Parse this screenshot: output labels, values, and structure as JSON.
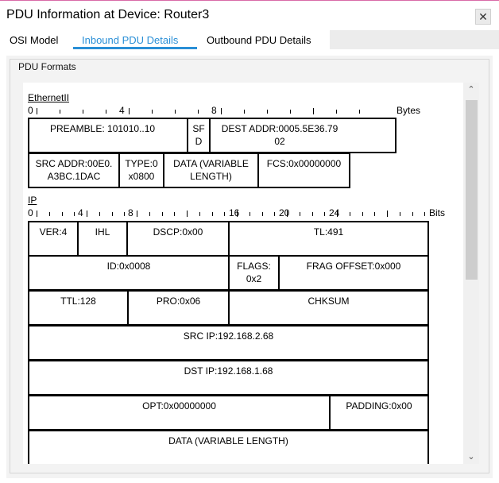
{
  "window": {
    "title": "PDU Information at Device: Router3",
    "close_glyph": "✕"
  },
  "tabs": [
    {
      "label": "OSI Model"
    },
    {
      "label": "Inbound PDU Details"
    },
    {
      "label": "Outbound PDU Details"
    }
  ],
  "active_tab": "Inbound PDU Details",
  "group": {
    "legend": "PDU Formats"
  },
  "ethernet": {
    "label": "EthernetII",
    "ruler": [
      "0",
      "4",
      "8"
    ],
    "unit": "Bytes",
    "row1": {
      "preamble": "PREAMBLE: 101010..10",
      "sfd": "SF\nD",
      "dest": "DEST ADDR:0005.5E36.79\n02"
    },
    "row2": {
      "src": "SRC ADDR:00E0.\nA3BC.1DAC",
      "type": "TYPE:0\nx0800",
      "data": "DATA (VARIABLE\nLENGTH)",
      "fcs": "FCS:0x00000000"
    }
  },
  "ip": {
    "label": "IP",
    "ruler": [
      "0",
      "4",
      "8",
      "16",
      "20",
      "24"
    ],
    "unit": "Bits",
    "ver": "VER:4",
    "ihl": "IHL",
    "dscp": "DSCP:0x00",
    "tl": "TL:491",
    "id": "ID:0x0008",
    "flags": "FLAGS:\n0x2",
    "frag": "FRAG OFFSET:0x000",
    "ttl": "TTL:128",
    "pro": "PRO:0x06",
    "chksum": "CHKSUM",
    "src": "SRC IP:192.168.2.68",
    "dst": "DST IP:192.168.1.68",
    "opt": "OPT:0x00000000",
    "padding": "PADDING:0x00",
    "data": "DATA (VARIABLE LENGTH)"
  },
  "scrollbar": {
    "up_glyph": "⌃",
    "down_glyph": "⌄"
  },
  "colors": {
    "accent": "#2a8fd6",
    "title_border": "#d96ba8",
    "panel_bg": "#f3f3f3"
  }
}
